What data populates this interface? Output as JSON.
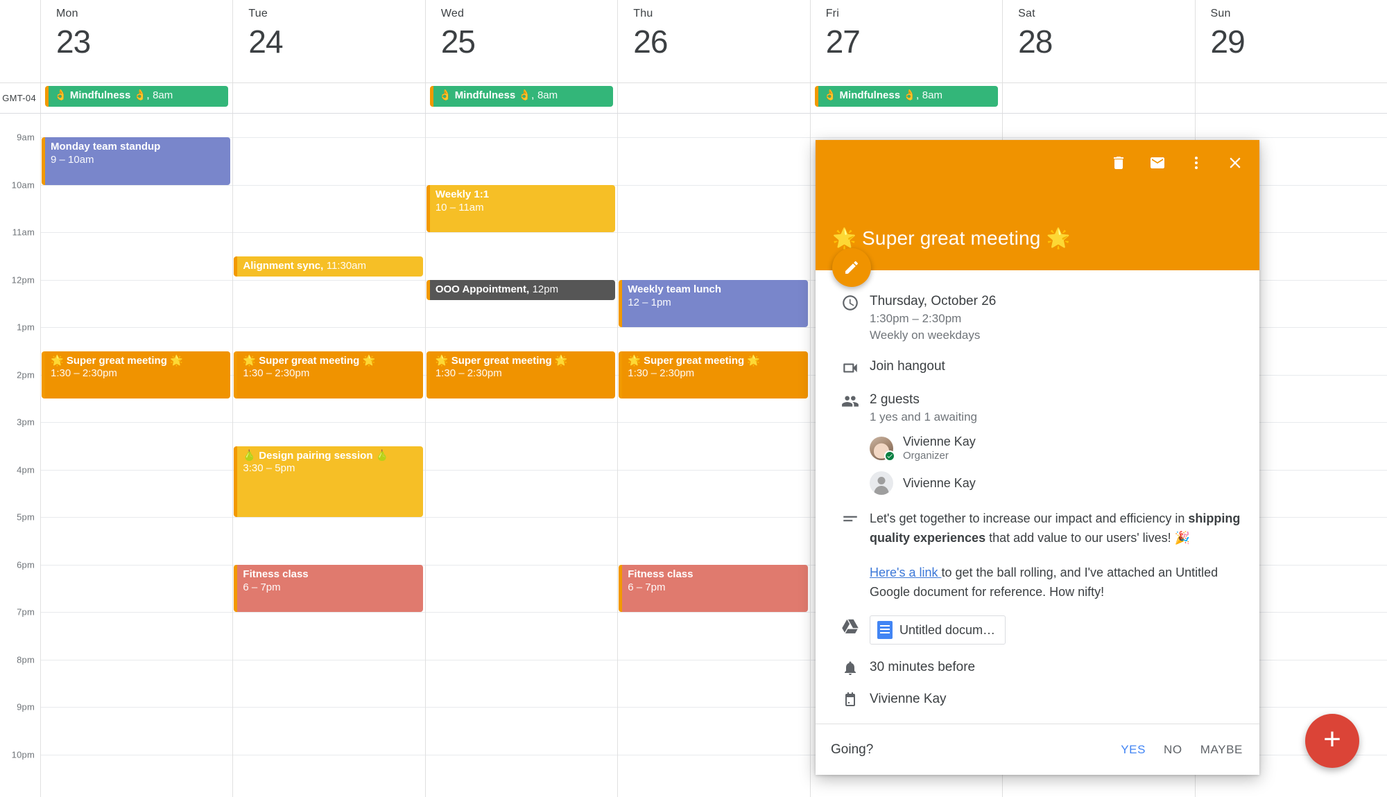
{
  "timezone_label": "GMT-04",
  "days": [
    {
      "name": "Mon",
      "num": "23"
    },
    {
      "name": "Tue",
      "num": "24"
    },
    {
      "name": "Wed",
      "num": "25"
    },
    {
      "name": "Thu",
      "num": "26"
    },
    {
      "name": "Fri",
      "num": "27"
    },
    {
      "name": "Sat",
      "num": "28"
    },
    {
      "name": "Sun",
      "num": "29"
    }
  ],
  "time_labels": [
    "9am",
    "10am",
    "11am",
    "12pm",
    "1pm",
    "2pm",
    "3pm",
    "4pm",
    "5pm",
    "6pm",
    "7pm",
    "8pm",
    "9pm",
    "10pm"
  ],
  "allday_events": [
    {
      "day": 0,
      "title": "👌 Mindfulness 👌",
      "time": "8am",
      "color": "green"
    },
    {
      "day": 2,
      "title": "👌 Mindfulness 👌",
      "time": "8am",
      "color": "green"
    },
    {
      "day": 4,
      "title": "👌 Mindfulness 👌",
      "time": "8am",
      "color": "green"
    }
  ],
  "events": [
    {
      "day": 0,
      "title": "Monday team standup",
      "time": "9 – 10am",
      "color": "purple",
      "start": 9.0,
      "end": 10.0,
      "oneline": false
    },
    {
      "day": 2,
      "title": "Weekly 1:1",
      "time": "10 – 11am",
      "color": "amber",
      "start": 10.0,
      "end": 11.0,
      "oneline": false
    },
    {
      "day": 1,
      "title": "Alignment sync,",
      "time": "11:30am",
      "color": "amber",
      "start": 11.5,
      "end": 11.93,
      "oneline": true
    },
    {
      "day": 2,
      "title": "OOO Appointment,",
      "time": "12pm",
      "color": "gray",
      "start": 12.0,
      "end": 12.43,
      "oneline": true
    },
    {
      "day": 3,
      "title": "Weekly team lunch",
      "time": "12 – 1pm",
      "color": "purple",
      "start": 12.0,
      "end": 13.0,
      "oneline": false
    },
    {
      "day": 0,
      "title": "🌟 Super great meeting 🌟",
      "time": "1:30 – 2:30pm",
      "color": "orange",
      "start": 13.5,
      "end": 14.5,
      "oneline": false
    },
    {
      "day": 1,
      "title": "🌟 Super great meeting 🌟",
      "time": "1:30 – 2:30pm",
      "color": "orange",
      "start": 13.5,
      "end": 14.5,
      "oneline": false
    },
    {
      "day": 2,
      "title": "🌟 Super great meeting 🌟",
      "time": "1:30 – 2:30pm",
      "color": "orange",
      "start": 13.5,
      "end": 14.5,
      "oneline": false
    },
    {
      "day": 3,
      "title": "🌟 Super great meeting 🌟",
      "time": "1:30 – 2:30pm",
      "color": "orange",
      "start": 13.5,
      "end": 14.5,
      "oneline": false
    },
    {
      "day": 1,
      "title": "🍐 Design pairing session 🍐",
      "time": "3:30 – 5pm",
      "color": "amber",
      "start": 15.5,
      "end": 17.0,
      "oneline": false
    },
    {
      "day": 1,
      "title": "Fitness class",
      "time": "6 – 7pm",
      "color": "red",
      "start": 18.0,
      "end": 19.0,
      "oneline": false
    },
    {
      "day": 3,
      "title": "Fitness class",
      "time": "6 – 7pm",
      "color": "red",
      "start": 18.0,
      "end": 19.0,
      "oneline": false
    }
  ],
  "fab": {
    "label": "+"
  },
  "popup": {
    "title": "🌟 Super great meeting 🌟",
    "actions": [
      {
        "name": "delete-event-button",
        "icon": "trash-icon"
      },
      {
        "name": "email-guests-button",
        "icon": "envelope-icon"
      },
      {
        "name": "more-options-button",
        "icon": "kebab-menu-icon"
      },
      {
        "name": "close-popup-button",
        "icon": "close-icon"
      }
    ],
    "edit_button_icon": "pencil-icon",
    "when": {
      "date": "Thursday, October 26",
      "time": "1:30pm – 2:30pm",
      "recurrence": "Weekly on weekdays"
    },
    "hangout": "Join hangout",
    "guests": {
      "count_label": "2 guests",
      "status_label": "1 yes and 1 awaiting",
      "list": [
        {
          "name": "Vivienne Kay",
          "role": "Organizer",
          "rsvp": "yes",
          "avatar": "photo"
        },
        {
          "name": "Vivienne Kay",
          "role": "",
          "rsvp": "awaiting",
          "avatar": "generic"
        }
      ]
    },
    "description": {
      "p1_a": "Let's get together to increase our impact and efficiency in ",
      "p1_bold": "shipping quality experiences",
      "p1_b": " that add value to our users' lives! 🎉",
      "p2_link": "Here's a link ",
      "p2_rest": "to get the ball rolling, and I've attached an Untitled Google document for reference. How nifty!"
    },
    "attachment": {
      "name": "Untitled docum…"
    },
    "reminder": "30 minutes before",
    "calendar_owner": "Vivienne Kay",
    "footer": {
      "going_label": "Going?",
      "yes": "YES",
      "no": "NO",
      "maybe": "MAYBE"
    }
  },
  "colors": {
    "accent_orange": "#f09300",
    "green": "#33b679",
    "purple": "#7986cb",
    "amber": "#f6bf26",
    "gray": "#565656",
    "red": "#e07a6e",
    "link_blue": "#3c78d8",
    "fab_red": "#db4437"
  }
}
